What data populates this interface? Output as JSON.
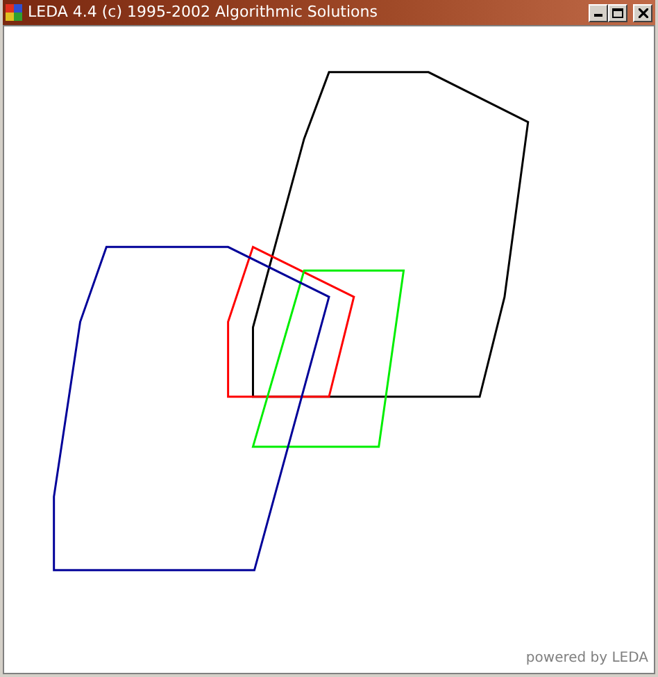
{
  "window": {
    "title": "LEDA 4.4 (c) 1995-2002 Algorithmic Solutions"
  },
  "polygons": [
    {
      "color": "#000000"
    },
    {
      "color": "#ff0000"
    },
    {
      "color": "#00ee00"
    },
    {
      "color": "#000099"
    }
  ],
  "footer": "powered by LEDA"
}
